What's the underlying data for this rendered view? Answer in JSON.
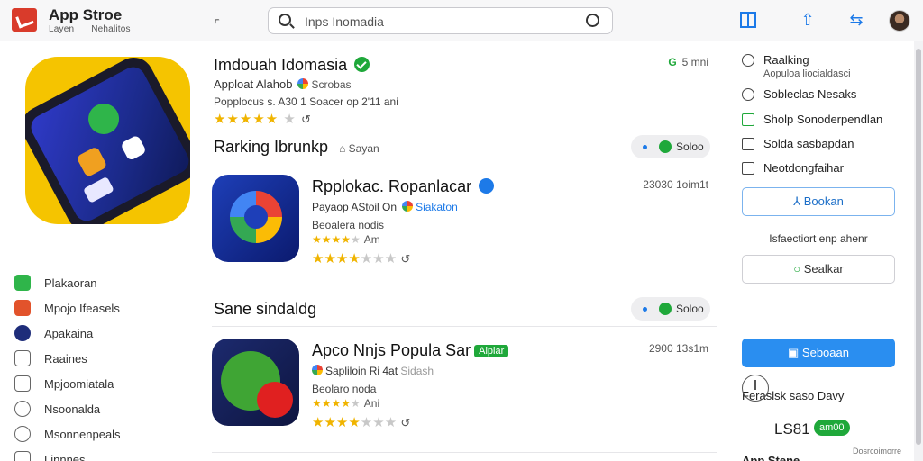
{
  "app": {
    "title": "App Stroe",
    "subtitle_1": "Layen",
    "subtitle_2": "Nehalitos"
  },
  "search": {
    "value": "Inps Inomadia"
  },
  "featured": {
    "title": "Imdouah Idomasia",
    "developer": "Apploat Alahob",
    "developer_tag": "Scrobas",
    "meta": "Popplocus s.  A30  1 Soacer op 2'11 ani",
    "rating": 4,
    "price": "5 mni"
  },
  "sections": [
    {
      "title": "Rarking Ibrunkp",
      "subtitle": "Sayan",
      "pill": "Soloo",
      "app": {
        "name": "Rpplokac. Ropanlacar",
        "developer": "Payaop AStoil  On",
        "developer_tag": "Siakaton",
        "category": "Beoalera nodis",
        "rating_text": "Am",
        "rating": 4.5,
        "size": "23030 1oim1t"
      }
    },
    {
      "title": "Sane sindaldg",
      "subtitle": "",
      "pill": "Soloo",
      "app": {
        "name": "Apco Nnjs Popula Sar",
        "badge": "Alpiar",
        "developer": "Sapliloin Ri  4at",
        "developer_tag": "Sidash",
        "category": "Beolaro noda",
        "rating_text": "Ani",
        "rating": 4,
        "size": "2900 13s1m"
      }
    }
  ],
  "sidebar": {
    "items": [
      {
        "label": "Plakaoran",
        "color": "#2fb54a"
      },
      {
        "label": "Mpojo Ifeasels",
        "color": "#e2532b"
      },
      {
        "label": "Apakaina",
        "color": "#1e2d7a"
      },
      {
        "label": "Raaines",
        "color": "#666666"
      },
      {
        "label": "Mpjoomiatala",
        "color": "#666666"
      },
      {
        "label": "Nsoonalda",
        "color": "#666666"
      },
      {
        "label": "Msonnenpeals",
        "color": "#666666"
      },
      {
        "label": "Linnnes",
        "color": "#666666"
      }
    ]
  },
  "right_panel": {
    "ranking_label": "Raalking",
    "ranking_sub": "Aopuloa liocialdasci",
    "item_2": "Sobleclas Nesaks",
    "item_3": "Sholp Sonoderpendlan",
    "item_4": "Solda sasbapdan",
    "item_5": "Neotdongfaihar",
    "button_1": "Bookan",
    "note": "Isfaectiort enp ahenr",
    "button_2": "Sealkar",
    "button_3": "Seboaan",
    "label_days": "Feraslsk saso Davy",
    "timer_value": "LS81",
    "timer_badge": "am00",
    "bottom_label": "App Stene",
    "bottom_note": "Dosrcoimorre"
  },
  "colors": {
    "accent": "#1d7ae8",
    "green": "#1fa83a",
    "star": "#f0b400"
  },
  "icons": [
    "search-icon",
    "microphone-icon",
    "back-icon",
    "grid-icon",
    "share-icon",
    "sync-icon",
    "verified-icon",
    "timer-icon"
  ]
}
